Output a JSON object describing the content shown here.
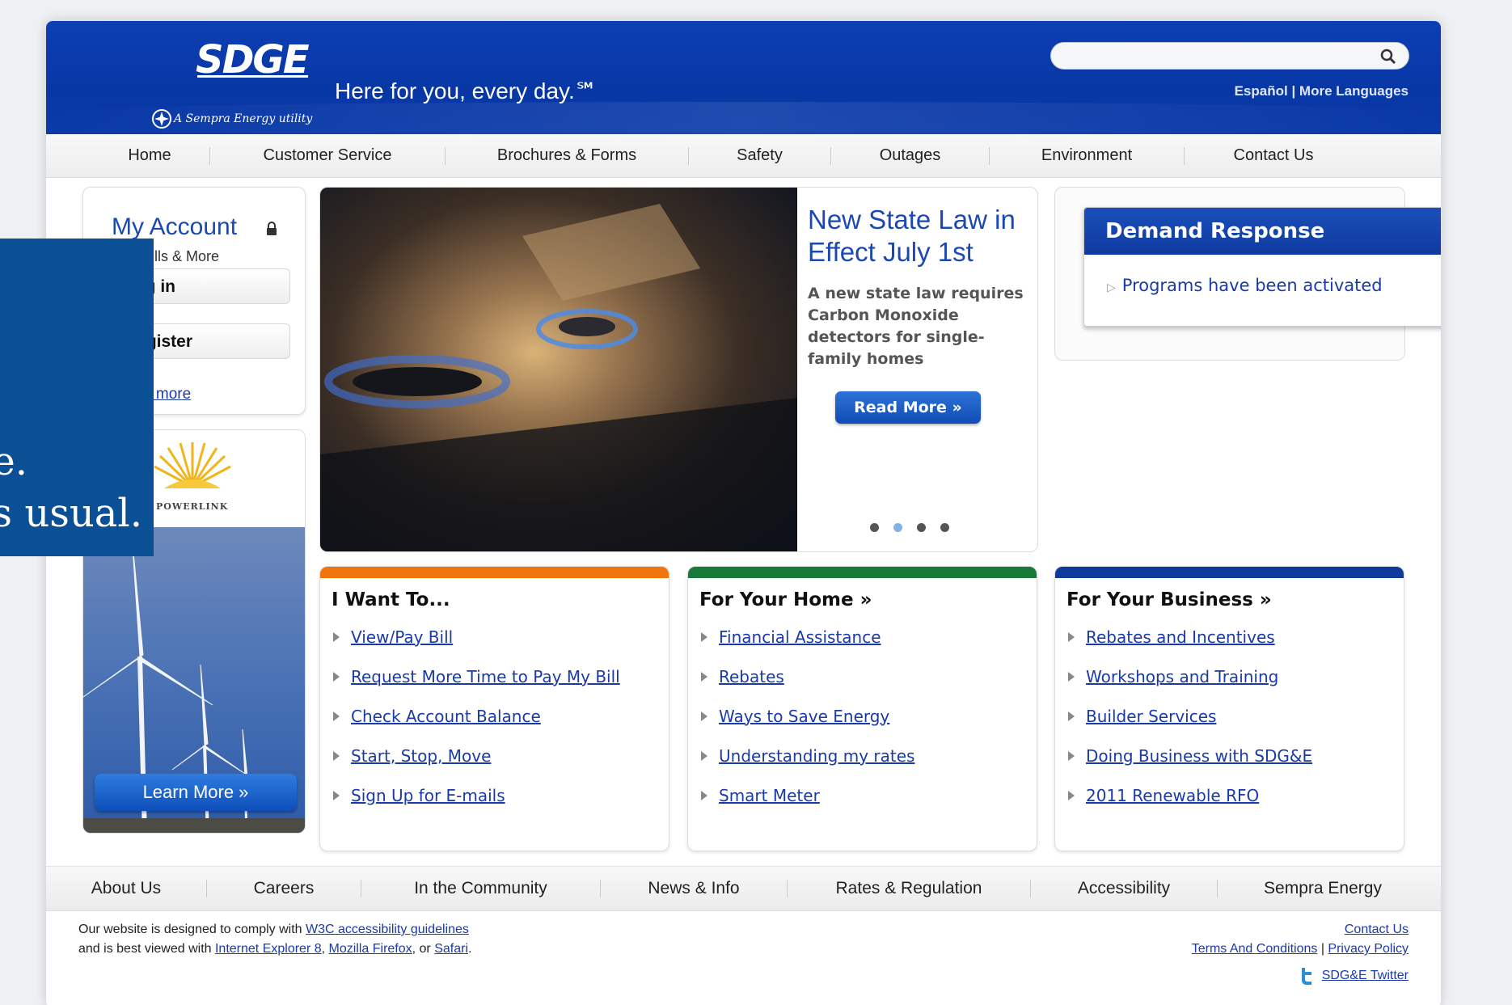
{
  "header": {
    "logo_text": "SDGE",
    "logo_sub": "A Sempra Energy utility",
    "tagline": "Here for you, every day.℠",
    "search": {
      "value": "",
      "icon": "search-icon"
    },
    "languages": "Español | More Languages"
  },
  "main_nav": [
    "Home",
    "Customer Service",
    "Brochures & Forms",
    "Safety",
    "Outages",
    "Environment",
    "Contact Us"
  ],
  "account": {
    "title": "My Account",
    "subtitle": "Pay Bills & More",
    "login": "Log in",
    "register": "Register",
    "learn_more": "Learn more"
  },
  "promo": {
    "brand": "SUNRISE POWERLINK",
    "button": "Learn More »"
  },
  "hero": {
    "title": "New State Law in Effect July 1st",
    "body": "A new state law requires Carbon Monoxide detectors for single-family homes",
    "button": "Read More »",
    "slides": 4,
    "active_slide": 2
  },
  "demand_response": {
    "title": "Demand Response",
    "item": "Programs have been activated"
  },
  "panels": [
    {
      "title": "I Want To...",
      "accent": "#f2740f",
      "links": [
        "View/Pay Bill",
        "Request More Time to Pay My Bill",
        "Check Account Balance",
        "Start, Stop, Move",
        "Sign Up for E-mails"
      ]
    },
    {
      "title": "For Your Home »",
      "accent": "#187a3a",
      "links": [
        "Financial Assistance",
        "Rebates",
        "Ways to Save Energy",
        "Understanding my rates",
        "Smart Meter"
      ]
    },
    {
      "title": "For Your Business »",
      "accent": "#0e3a9c",
      "links": [
        "Rebates and Incentives",
        "Workshops and Training",
        "Builder Services",
        "Doing Business with SDG&E",
        "2011 Renewable RFO"
      ]
    }
  ],
  "footer_nav": [
    "About Us",
    "Careers",
    "In the Community",
    "News & Info",
    "Rates & Regulation",
    "Accessibility",
    "Sempra Energy"
  ],
  "footer": {
    "line1_pre": "Our website is designed to comply with ",
    "line1_link": "W3C accessibility guidelines",
    "line2_pre": "and is best viewed with ",
    "ie": "Internet Explorer 8",
    "firefox": "Mozilla Firefox",
    "or": ", or ",
    "safari": "Safari",
    "comma": ", ",
    "dot": ".",
    "contact": "Contact Us",
    "terms": "Terms And Conditions",
    "pipe": " | ",
    "privacy": "Privacy Policy",
    "twitter": "SDG&E Twitter"
  },
  "overlay": {
    "line1": "e.",
    "line2": "s usual."
  },
  "colors": {
    "brand_blue": "#0837a5",
    "link": "#1a3aa8",
    "overlay": "#0b4f94"
  }
}
